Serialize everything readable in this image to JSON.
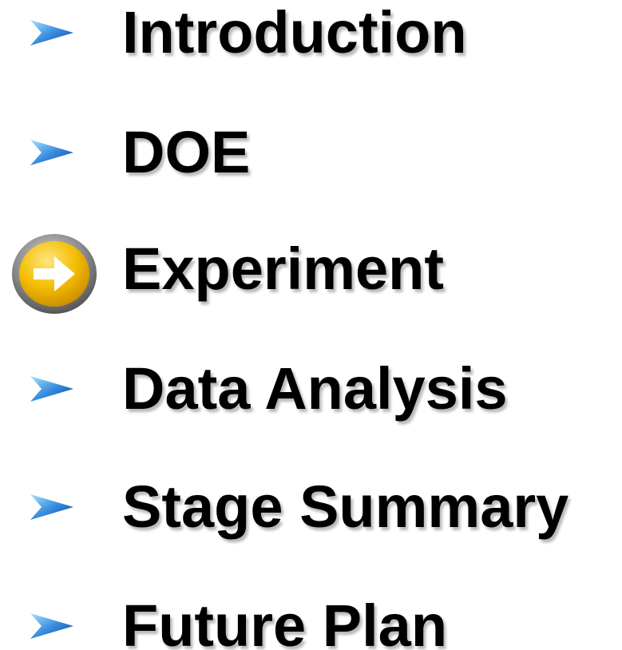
{
  "agenda": {
    "items": [
      {
        "label": "Introduction",
        "marker": "chevron-icon"
      },
      {
        "label": "DOE",
        "marker": "chevron-icon"
      },
      {
        "label": "Experiment",
        "marker": "arrow-circle-icon",
        "current": true
      },
      {
        "label": "Data Analysis",
        "marker": "chevron-icon"
      },
      {
        "label": "Stage Summary",
        "marker": "chevron-icon"
      },
      {
        "label": "Future Plan",
        "marker": "chevron-icon"
      }
    ]
  },
  "colors": {
    "chevron_light": "#8fd6ff",
    "chevron_dark": "#1a4fb8",
    "current_fill": "#f2b800",
    "current_ring": "#7a7a7a",
    "text": "#000000"
  }
}
